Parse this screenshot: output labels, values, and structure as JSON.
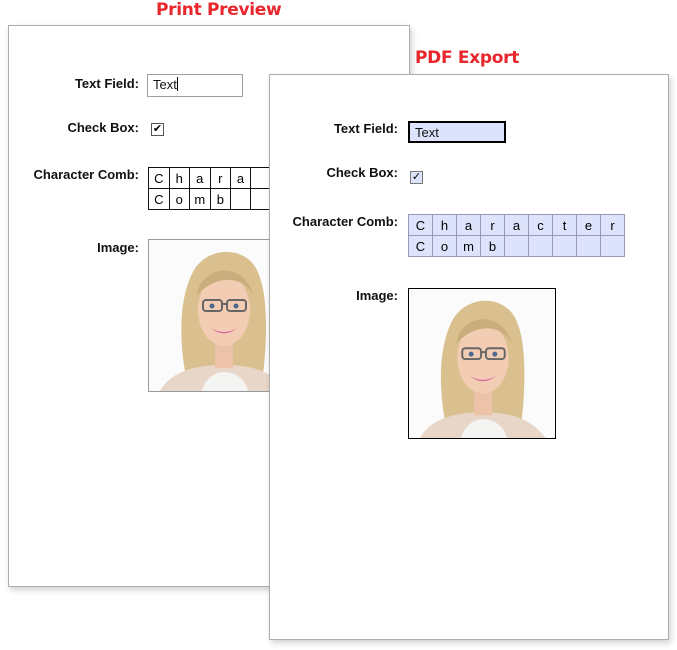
{
  "titles": {
    "print_preview": "Print Preview",
    "pdf_export": "PDF Export"
  },
  "colors": {
    "title_red": "#e8262c",
    "pdf_field_fill": "#dde3fb"
  },
  "print_preview": {
    "text_field": {
      "label": "Text Field:",
      "value": "Text"
    },
    "check_box": {
      "label": "Check Box:",
      "checked": true,
      "glyph": "✔"
    },
    "character_comb": {
      "label": "Character Comb:",
      "rows": [
        [
          "C",
          "h",
          "a",
          "r",
          "a"
        ],
        [
          "C",
          "o",
          "m",
          "b",
          ""
        ]
      ]
    },
    "image": {
      "label": "Image:",
      "icon": "portrait-photo"
    }
  },
  "pdf_export": {
    "text_field": {
      "label": "Text Field:",
      "value": "Text"
    },
    "check_box": {
      "label": "Check Box:",
      "checked": true,
      "glyph": "✓"
    },
    "character_comb": {
      "label": "Character Comb:",
      "rows": [
        [
          "C",
          "h",
          "a",
          "r",
          "a",
          "c",
          "t",
          "e",
          "r"
        ],
        [
          "C",
          "o",
          "m",
          "b",
          "",
          "",
          "",
          "",
          ""
        ]
      ]
    },
    "image": {
      "label": "Image:",
      "icon": "portrait-photo"
    }
  }
}
